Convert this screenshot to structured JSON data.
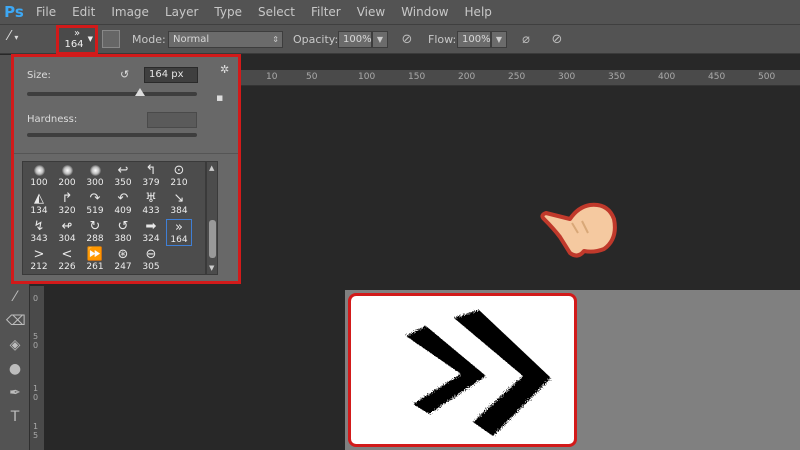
{
  "app": {
    "logo": "Ps"
  },
  "menu": [
    "File",
    "Edit",
    "Image",
    "Layer",
    "Type",
    "Select",
    "Filter",
    "View",
    "Window",
    "Help"
  ],
  "options": {
    "brush_preset_size": "164",
    "brush_preset_shape": "»",
    "mode_label": "Mode:",
    "mode_value": "Normal",
    "opacity_label": "Opacity:",
    "opacity_value": "100%",
    "flow_label": "Flow:",
    "flow_value": "100%"
  },
  "brush_popup": {
    "size_label": "Size:",
    "size_value": "164 px",
    "size_level": 0.66,
    "hardness_label": "Hardness:",
    "brushes": [
      {
        "num": "100",
        "shape": "soft"
      },
      {
        "num": "200",
        "shape": "soft"
      },
      {
        "num": "300",
        "shape": "soft"
      },
      {
        "num": "350",
        "shape": "↩"
      },
      {
        "num": "379",
        "shape": "↰"
      },
      {
        "num": "210",
        "shape": "⊙"
      },
      {
        "num": "134",
        "shape": "◭"
      },
      {
        "num": "320",
        "shape": "↱"
      },
      {
        "num": "519",
        "shape": "↷"
      },
      {
        "num": "409",
        "shape": "↶"
      },
      {
        "num": "433",
        "shape": "♅"
      },
      {
        "num": "384",
        "shape": "↘"
      },
      {
        "num": "343",
        "shape": "↯"
      },
      {
        "num": "304",
        "shape": "↫"
      },
      {
        "num": "288",
        "shape": "↻"
      },
      {
        "num": "380",
        "shape": "↺"
      },
      {
        "num": "324",
        "shape": "➡"
      },
      {
        "num": "164",
        "shape": "»"
      },
      {
        "num": "212",
        "shape": ">"
      },
      {
        "num": "226",
        "shape": "<"
      },
      {
        "num": "261",
        "shape": "⏩"
      },
      {
        "num": "247",
        "shape": "⊛"
      },
      {
        "num": "305",
        "shape": "⊖"
      }
    ],
    "selected_index": 17
  },
  "ruler": {
    "top_ticks": [
      "10",
      "50",
      "100",
      "150",
      "200",
      "250",
      "300",
      "350",
      "400",
      "450",
      "500"
    ]
  },
  "tools": [
    "brush-icon",
    "eraser-icon",
    "paint-bucket-icon",
    "dodge-icon",
    "pen-icon",
    "type-icon"
  ],
  "colors": {
    "highlight": "#d21a1a",
    "selection": "#3f7fd6"
  }
}
